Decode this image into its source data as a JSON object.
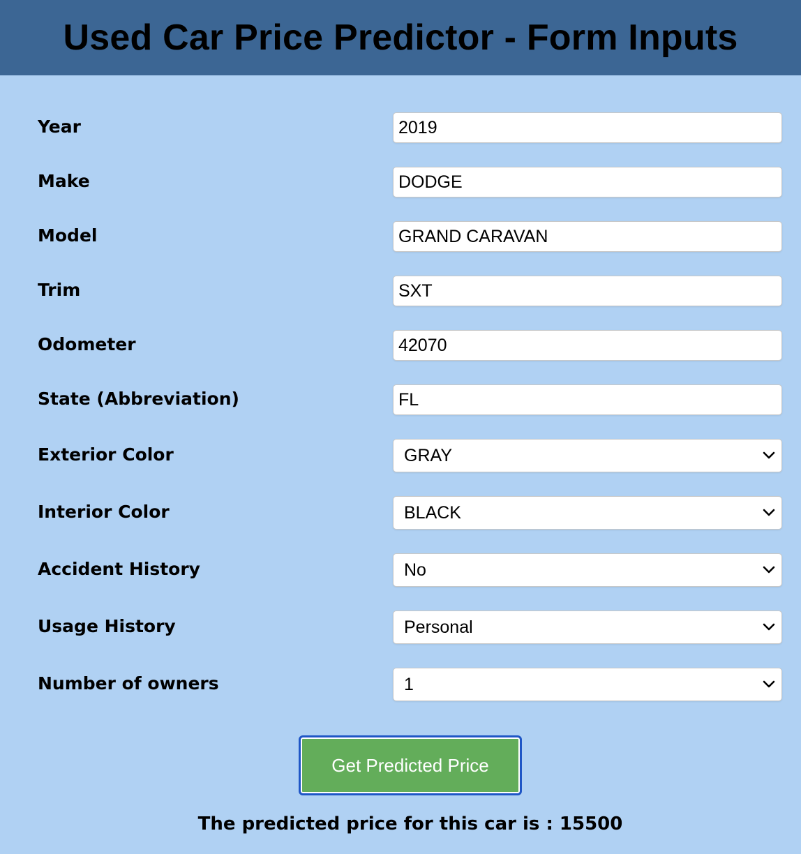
{
  "header": {
    "title": "Used Car Price Predictor - Form Inputs"
  },
  "form": {
    "year": {
      "label": "Year",
      "value": "2019"
    },
    "make": {
      "label": "Make",
      "value": "DODGE"
    },
    "model": {
      "label": "Model",
      "value": "GRAND CARAVAN"
    },
    "trim": {
      "label": "Trim",
      "value": "SXT"
    },
    "odometer": {
      "label": "Odometer",
      "value": "42070"
    },
    "state": {
      "label": "State (Abbreviation)",
      "value": "FL"
    },
    "exterior_color": {
      "label": "Exterior Color",
      "selected": "GRAY"
    },
    "interior_color": {
      "label": "Interior Color",
      "selected": "BLACK"
    },
    "accident_history": {
      "label": "Accident History",
      "selected": "No"
    },
    "usage_history": {
      "label": "Usage History",
      "selected": "Personal"
    },
    "owners": {
      "label": "Number of owners",
      "selected": "1"
    }
  },
  "submit": {
    "label": "Get Predicted Price"
  },
  "result": {
    "text": "The predicted price for this car is : 15500"
  },
  "colors": {
    "header_bg": "#3c6694",
    "page_bg": "#b0d1f3",
    "button_bg": "#63ad5a",
    "button_focus_ring": "#1f56c6"
  },
  "icons": {
    "select_arrow": "chevron-down-icon"
  }
}
